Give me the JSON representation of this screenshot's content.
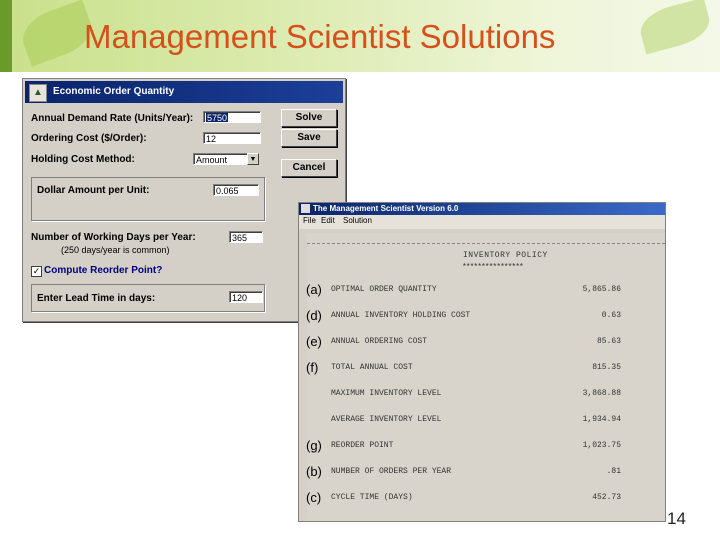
{
  "slide": {
    "title": "Management Scientist Solutions",
    "page_number": "14"
  },
  "eoq_window": {
    "title": "Economic Order Quantity",
    "fields": {
      "demand_label": "Annual Demand Rate (Units/Year):",
      "demand_value": "5750",
      "ordering_label": "Ordering Cost ($/Order):",
      "ordering_value": "12",
      "holding_method_label": "Holding Cost Method:",
      "holding_method_value": "Amount",
      "dollar_label": "Dollar Amount per Unit:",
      "dollar_value": "0.065",
      "working_days_label": "Number of Working Days per Year:",
      "working_days_value": "365",
      "working_days_hint": "(250 days/year is common)",
      "reorder_check_label": "Compute Reorder Point?",
      "reorder_checked": true,
      "lead_time_label": "Enter Lead Time in days:",
      "lead_time_value": "120"
    },
    "buttons": {
      "solve": "Solve",
      "save": "Save",
      "cancel": "Cancel"
    }
  },
  "report_window": {
    "title": "The Management Scientist Version 6.0",
    "menu": [
      "File",
      "Edit",
      "Solution"
    ],
    "heading": "INVENTORY POLICY",
    "heading_underline": "****************",
    "rows": [
      {
        "tag": "(a)",
        "label": "OPTIMAL ORDER QUANTITY",
        "value": "5,865.86"
      },
      {
        "tag": "(d)",
        "label": "ANNUAL INVENTORY HOLDING COST",
        "value": "0.63"
      },
      {
        "tag": "(e)",
        "label": "ANNUAL ORDERING COST",
        "value": "85.63"
      },
      {
        "tag": "(f)",
        "label": "TOTAL ANNUAL COST",
        "value": "815.35"
      },
      {
        "tag": "",
        "label": "MAXIMUM INVENTORY LEVEL",
        "value": "3,868.88"
      },
      {
        "tag": "",
        "label": "AVERAGE INVENTORY LEVEL",
        "value": "1,934.94"
      },
      {
        "tag": "(g)",
        "label": "REORDER POINT",
        "value": "1,023.75"
      },
      {
        "tag": "(b)",
        "label": "NUMBER OF ORDERS PER YEAR",
        "value": ".81"
      },
      {
        "tag": "(c)",
        "label": "CYCLE TIME (DAYS)",
        "value": "452.73"
      }
    ]
  }
}
